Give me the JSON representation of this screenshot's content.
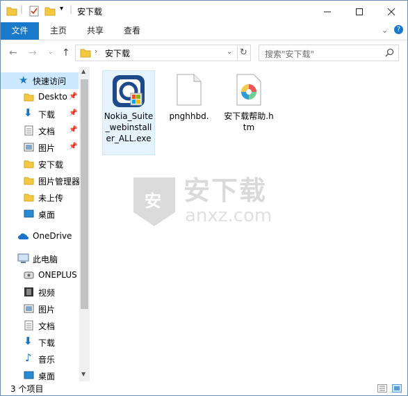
{
  "window": {
    "title": "安下载"
  },
  "ribbon": {
    "tabs": [
      "文件",
      "主页",
      "共享",
      "查看"
    ]
  },
  "address": {
    "path": "安下载",
    "search_placeholder": "搜索\"安下载\""
  },
  "sidebar": {
    "items": [
      {
        "label": "快速访问",
        "icon": "star-icon"
      },
      {
        "label": "Deskto",
        "icon": "folder-icon",
        "pinned": true
      },
      {
        "label": "下载",
        "icon": "download-icon",
        "pinned": true
      },
      {
        "label": "文档",
        "icon": "document-icon",
        "pinned": true
      },
      {
        "label": "图片",
        "icon": "picture-icon",
        "pinned": true
      },
      {
        "label": "安下载",
        "icon": "folder-icon"
      },
      {
        "label": "图片管理器",
        "icon": "folder-icon"
      },
      {
        "label": "未上传",
        "icon": "folder-icon"
      },
      {
        "label": "桌面",
        "icon": "desktop-icon"
      },
      {
        "label": "OneDrive",
        "icon": "cloud-icon"
      },
      {
        "label": "此电脑",
        "icon": "computer-icon"
      },
      {
        "label": "ONEPLUS",
        "icon": "phone-icon"
      },
      {
        "label": "视频",
        "icon": "video-icon"
      },
      {
        "label": "图片",
        "icon": "picture-icon"
      },
      {
        "label": "文档",
        "icon": "document-icon"
      },
      {
        "label": "下载",
        "icon": "download-icon"
      },
      {
        "label": "音乐",
        "icon": "music-icon"
      },
      {
        "label": "桌面",
        "icon": "desktop-icon"
      }
    ]
  },
  "files": [
    {
      "name": "Nokia_Suite_webinstaller_ALL.exe",
      "icon": "nokia-installer-icon"
    },
    {
      "name": "pnghhbd.",
      "icon": "blank-file-icon"
    },
    {
      "name": "安下载帮助.htm",
      "icon": "html-file-icon"
    }
  ],
  "status": {
    "count": "3 个项目"
  },
  "watermark": {
    "brand": "安下载",
    "domain": "anxz.com",
    "badge": "安"
  },
  "colors": {
    "accent": "#1979ca",
    "selection": "#cce8ff"
  }
}
